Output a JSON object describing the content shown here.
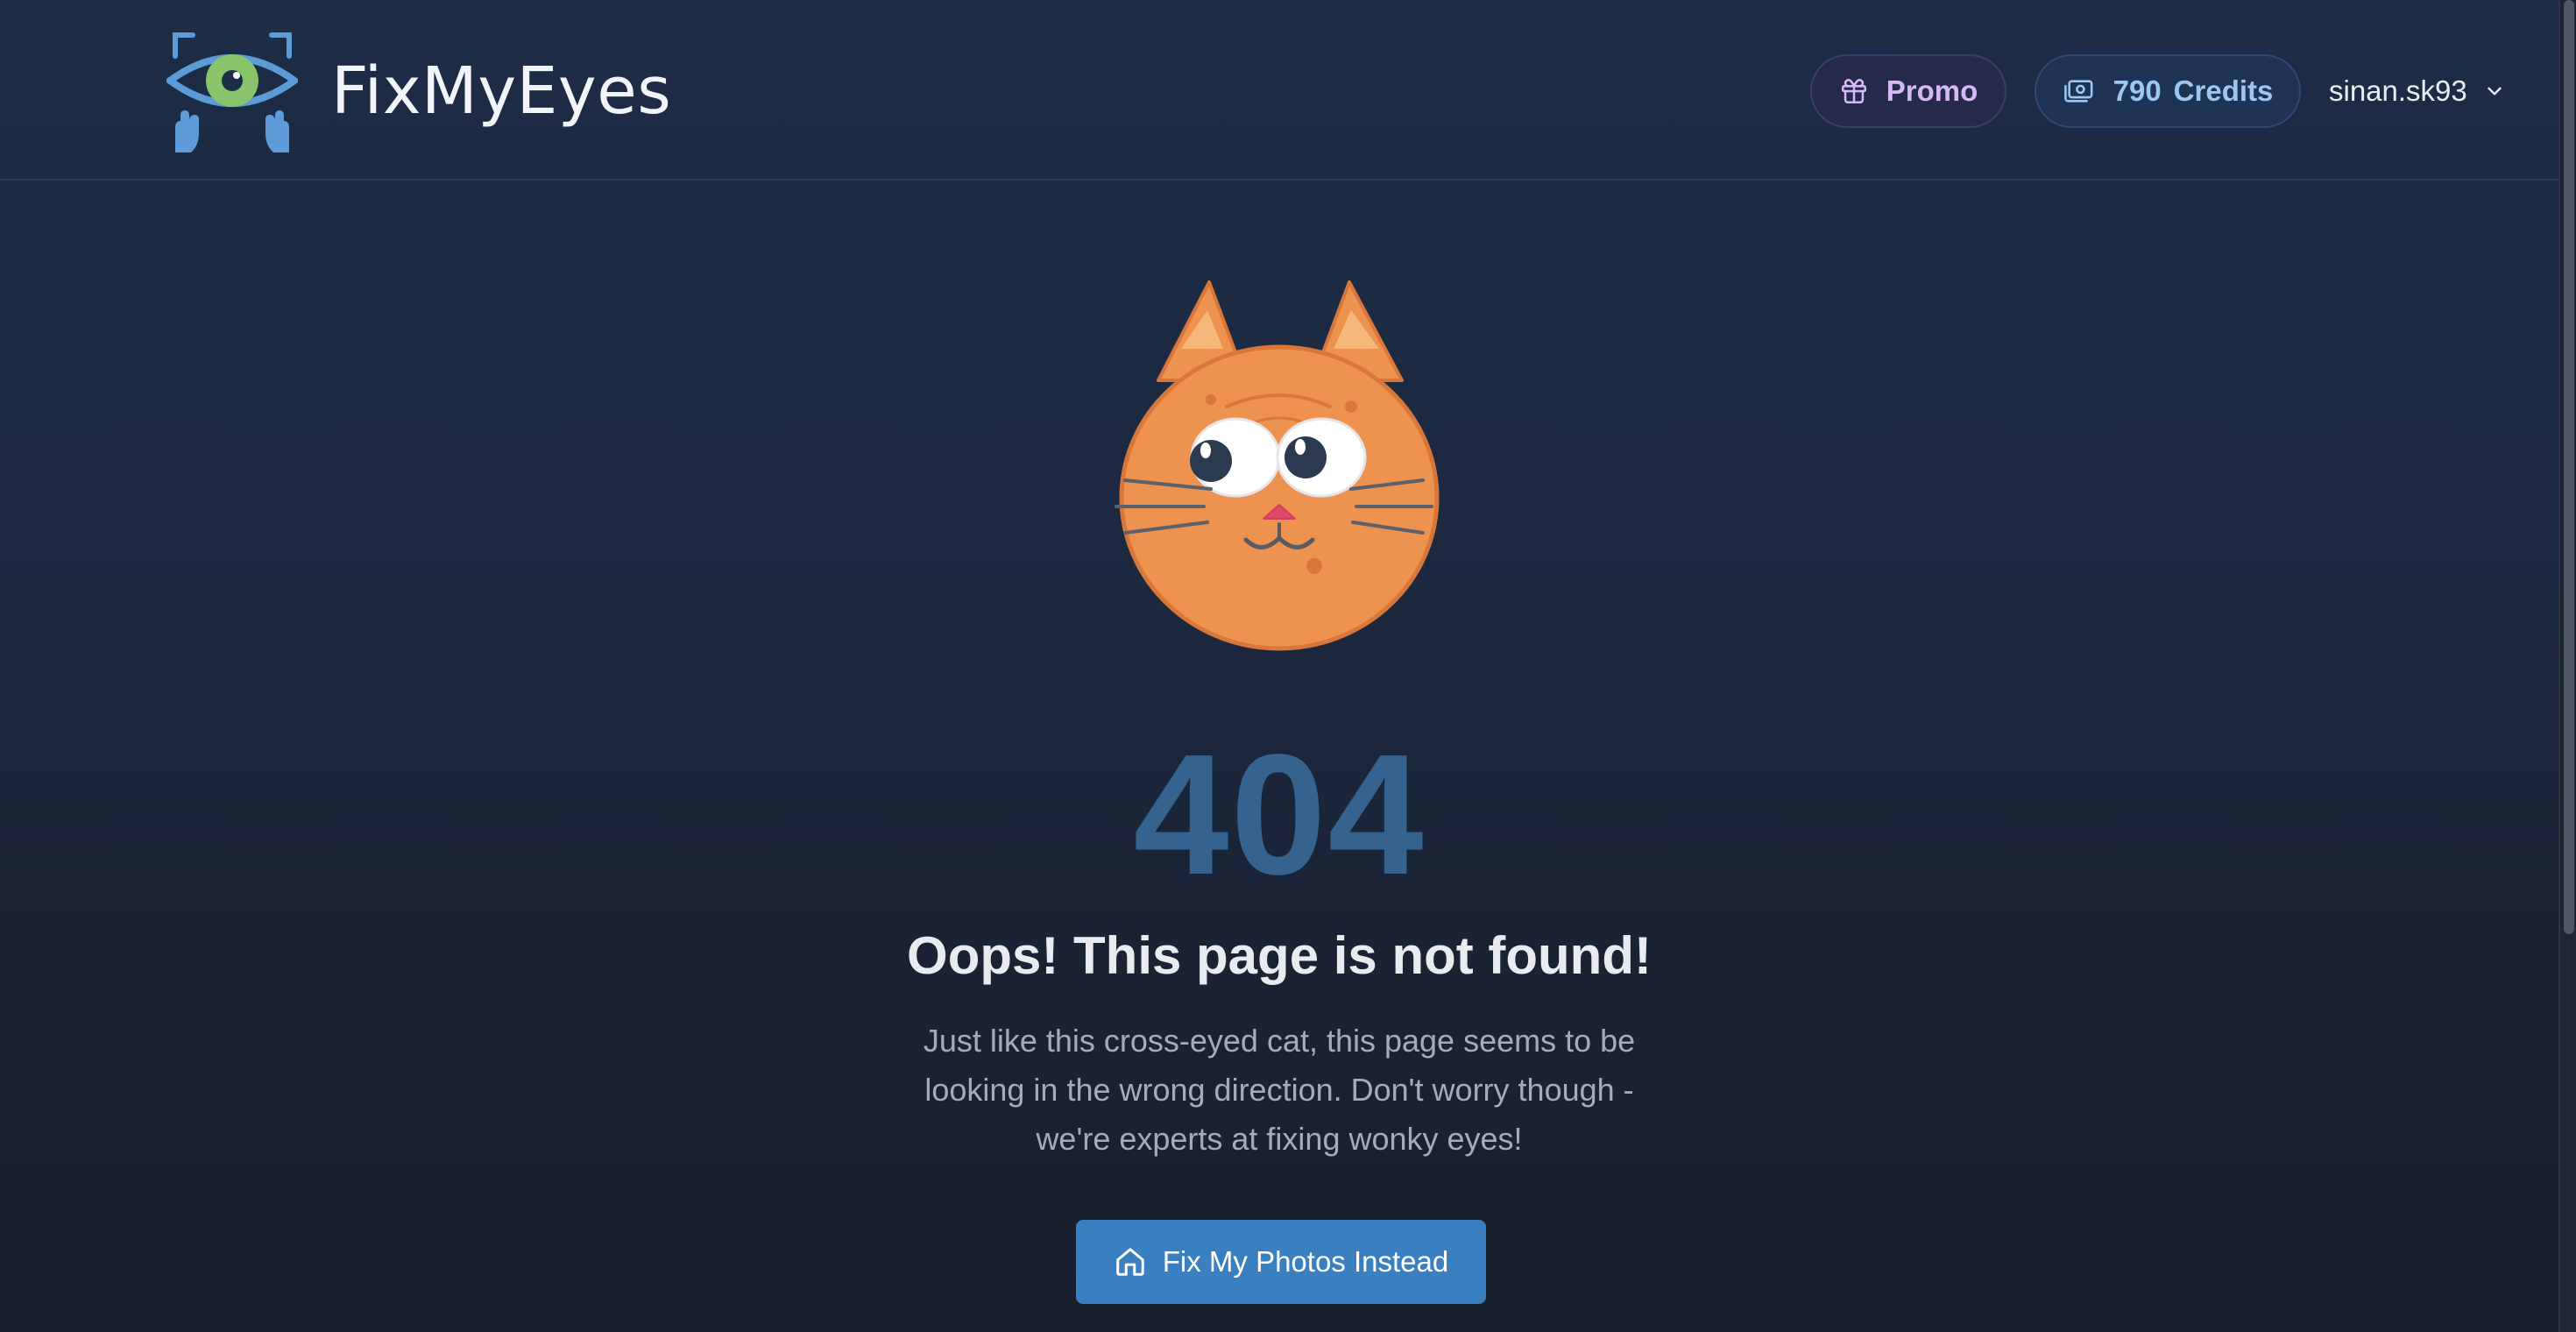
{
  "header": {
    "brand": "FixMyEyes",
    "logo_icon": "eye-scan-hands-logo",
    "promo_label": "Promo",
    "promo_icon": "gift-icon",
    "credits_count": "790",
    "credits_label": "Credits",
    "credits_icon": "banknote-icon",
    "username": "sinan.sk93",
    "user_menu_icon": "chevron-down-icon"
  },
  "main": {
    "illustration": "cross-eyed-cat",
    "error_code": "404",
    "title": "Oops! This page is not found!",
    "description": "Just like this cross-eyed cat, this page seems to be looking in the wrong direction. Don't worry though - we're experts at fixing wonky eyes!",
    "cta_label": "Fix My Photos Instead",
    "cta_icon": "home-icon"
  },
  "colors": {
    "background": "#1c2940",
    "error_code": "#35628f",
    "cta": "#3a7fc0",
    "promo_text": "#d7b8f6",
    "credits_text": "#9fc6f2",
    "cat_fur": "#ee924f",
    "logo_blue": "#5d9ad8",
    "logo_iris": "#8ac46a"
  }
}
